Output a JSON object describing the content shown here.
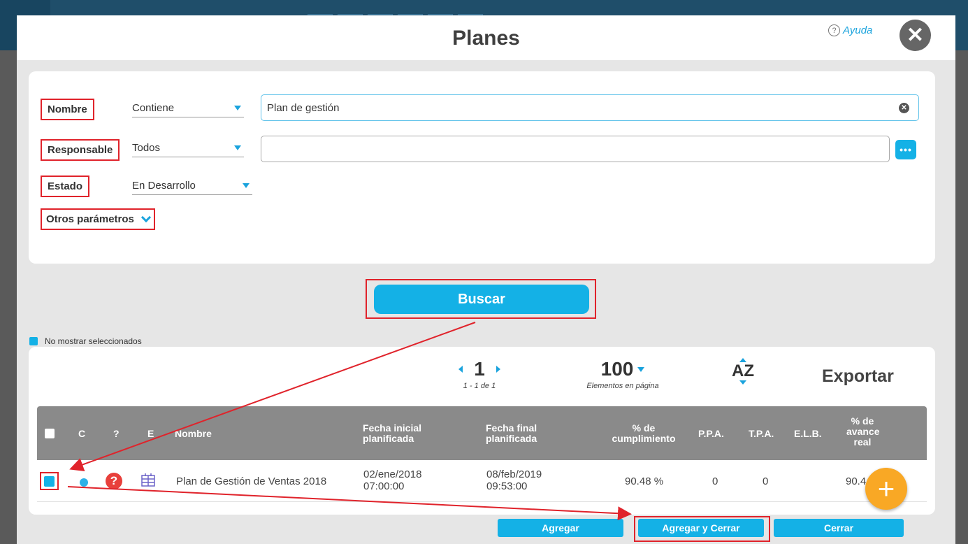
{
  "modal": {
    "title": "Planes",
    "help_label": "Ayuda",
    "help_icon": "question-circle-icon",
    "close_glyph": "✕"
  },
  "filters": {
    "nombre": {
      "label": "Nombre",
      "operator": "Contiene",
      "value": "Plan de gestión"
    },
    "responsable": {
      "label": "Responsable",
      "operator": "Todos",
      "value": "",
      "picker_glyph": "•••"
    },
    "estado": {
      "label": "Estado",
      "value": "En Desarrollo"
    },
    "otros_label": "Otros parámetros"
  },
  "buscar_label": "Buscar",
  "no_mostrar_label": "No mostrar seleccionados",
  "pagination": {
    "page": "1",
    "range": "1 - 1 de 1",
    "per_page": "100",
    "per_page_label": "Elementos en página",
    "sort_label": "AZ",
    "export_label": "Exportar"
  },
  "table": {
    "headers": {
      "c": "C",
      "q": "?",
      "e": "E",
      "nombre": "Nombre",
      "fecha_inicial": [
        "Fecha inicial",
        "planificada"
      ],
      "fecha_final": [
        "Fecha final",
        "planificada"
      ],
      "cumplimiento": [
        "% de",
        "cumplimiento"
      ],
      "ppa": "P.P.A.",
      "tpa": "T.P.A.",
      "elb": "E.L.B.",
      "avance": [
        "% de",
        "avance",
        "real"
      ]
    },
    "rows": [
      {
        "nombre": "Plan de Gestión de Ventas 2018",
        "fecha_inicial": [
          "02/ene/2018",
          "07:00:00"
        ],
        "fecha_final": [
          "08/feb/2019",
          "09:53:00"
        ],
        "cumplimiento": "90.48 %",
        "ppa": "0",
        "tpa": "0",
        "elb": "",
        "avance": "90.4",
        "status_icon": "question-mark-icon",
        "type_icon": "plan-icon"
      }
    ]
  },
  "fab_glyph": "+",
  "footer": {
    "agregar": "Agregar",
    "agregar_cerrar": "Agregar y Cerrar",
    "cerrar": "Cerrar"
  },
  "colors": {
    "accent": "#14b1e6",
    "annotation": "#e0232b",
    "fab": "#f9a825",
    "header_gray": "#8a8a8a"
  }
}
